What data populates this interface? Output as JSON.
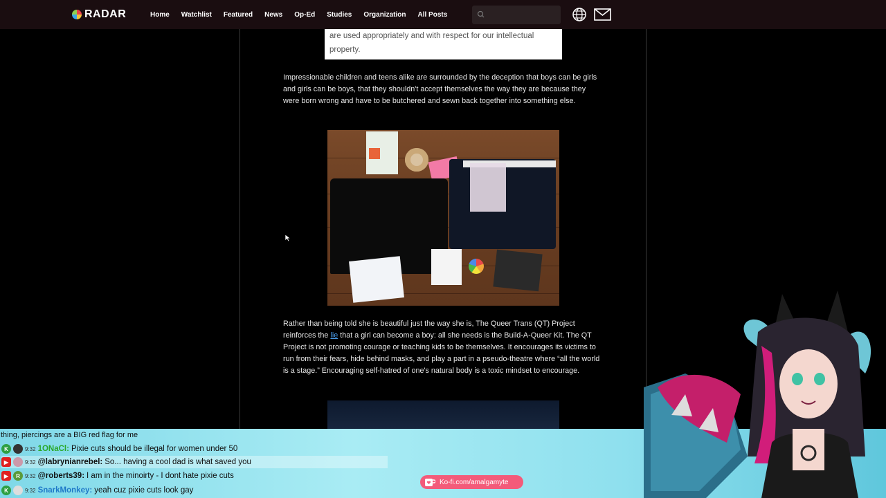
{
  "nav": {
    "logo": "RADAR",
    "links": [
      "Home",
      "Watchlist",
      "Featured",
      "News",
      "Op-Ed",
      "Studies",
      "Organization",
      "All Posts"
    ]
  },
  "article": {
    "quote_text": "are used appropriately and with respect for our intellectual property.",
    "para1": "Impressionable children and teens alike are surrounded by the deception that boys can be girls and girls can be boys, that they shouldn't accept themselves the way they are because they were born wrong and have to be butchered and sewn back together into something else.",
    "para2_before": "Rather than being told she is beautiful just the way she is, The Queer Trans (QT) Project reinforces the ",
    "para2_link": "lie",
    "para2_after": " that a girl can become a boy: all she needs is the Build-A-Queer Kit. The QT Project is not promoting courage or teaching kids to be themselves. It encourages its victims to run from their fears, hide behind masks, and play a part in a pseudo-theatre where “all the world is a stage.” Encouraging self-hatred of one's natural body is a toxic mindset to encourage."
  },
  "chat": {
    "partial_line": "thing, piercings are a BIG red flag for me",
    "messages": [
      {
        "badge": "K",
        "time": "9:32",
        "user": "1ONaCl:",
        "text": "Pixie cuts should be illegal for women under 50"
      },
      {
        "badge": "YT",
        "time": "9:32",
        "user": "@labrynianrebel:",
        "text": "So... having a cool dad is what saved you"
      },
      {
        "badge": "YT",
        "time": "9:32",
        "user": "@roberts39:",
        "text": "I am in the minoirty - I dont hate pixie cuts"
      },
      {
        "badge": "K",
        "time": "9:32",
        "user": "SnarkMonkey:",
        "text": "yeah cuz pixie cuts look gay"
      }
    ]
  },
  "kofi": {
    "label": "Ko-fi.com/amalgamyte"
  },
  "colors": {
    "nav_bg": "#1a0d10",
    "link": "#4a9be8",
    "chat_band": "#a9ecf4",
    "kofi": "#f35b7a"
  }
}
